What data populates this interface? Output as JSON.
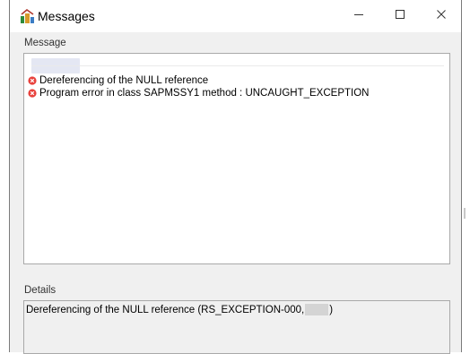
{
  "window": {
    "title": "Messages",
    "app_icon": "sap-app-icon",
    "controls": {
      "minimize": "minimize-icon",
      "maximize": "maximize-icon",
      "close": "close-icon"
    }
  },
  "message_section": {
    "label": "Message",
    "items": [
      {
        "type": "error",
        "icon": "error-icon",
        "text": "Dereferencing of the NULL reference"
      },
      {
        "type": "error",
        "icon": "error-icon",
        "text": "Program error in class SAPMSSY1 method : UNCAUGHT_EXCEPTION"
      }
    ]
  },
  "details_section": {
    "label": "Details",
    "text_prefix": "Dereferencing of the NULL reference (RS_EXCEPTION-000,",
    "text_suffix": ")"
  },
  "colors": {
    "error": "#e8413c",
    "window_bg": "#f0f0f0",
    "titlebar_bg": "#ffffff"
  }
}
